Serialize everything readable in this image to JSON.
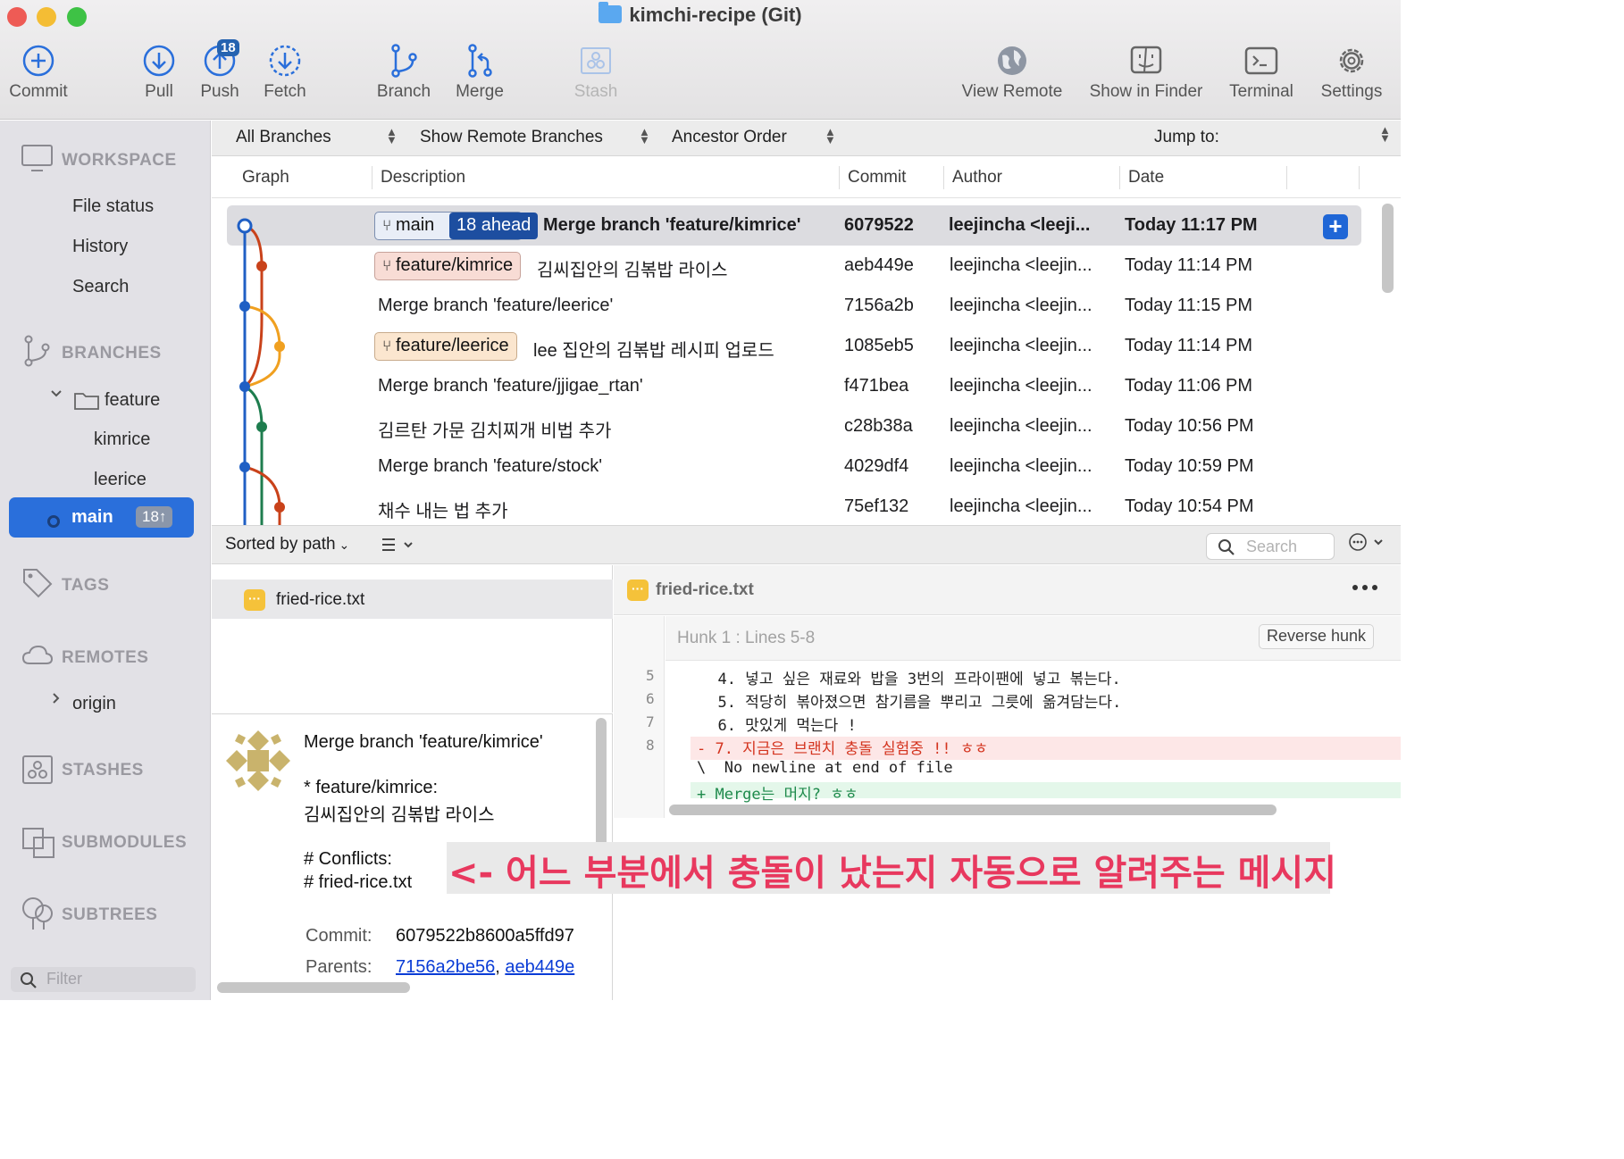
{
  "window": {
    "title": "kimchi-recipe (Git)"
  },
  "toolbar": {
    "commit": "Commit",
    "pull": "Pull",
    "push": "Push",
    "push_badge": "18",
    "fetch": "Fetch",
    "branch": "Branch",
    "merge": "Merge",
    "stash": "Stash",
    "view_remote": "View Remote",
    "show_in_finder": "Show in Finder",
    "terminal": "Terminal",
    "settings": "Settings"
  },
  "sidebar": {
    "workspace": "WORKSPACE",
    "workspace_items": [
      "File status",
      "History",
      "Search"
    ],
    "branches": "BRANCHES",
    "folder": "feature",
    "folder_items": [
      "kimrice",
      "leerice"
    ],
    "current_branch": "main",
    "current_badge": "18↑",
    "tags": "TAGS",
    "remotes": "REMOTES",
    "remote_items": [
      "origin"
    ],
    "stashes": "STASHES",
    "submodules": "SUBMODULES",
    "subtrees": "SUBTREES",
    "filter_placeholder": "Filter"
  },
  "filterbar": {
    "branches": "All Branches",
    "remote": "Show Remote Branches",
    "order": "Ancestor Order",
    "jump": "Jump to:"
  },
  "columns": {
    "graph": "Graph",
    "description": "Description",
    "commit": "Commit",
    "author": "Author",
    "date": "Date"
  },
  "commits": [
    {
      "branch": "main",
      "ahead": "18 ahead",
      "description": "Merge branch 'feature/kimrice'",
      "hash": "6079522",
      "author": "leejincha <leeji...",
      "date": "Today 11:17 PM"
    },
    {
      "branch": "feature/kimrice",
      "description": "김씨집안의 김볶밥 라이스",
      "hash": "aeb449e",
      "author": "leejincha <leejin...",
      "date": "Today 11:14 PM"
    },
    {
      "description": "Merge branch 'feature/leerice'",
      "hash": "7156a2b",
      "author": "leejincha <leejin...",
      "date": "Today 11:15 PM"
    },
    {
      "branch": "feature/leerice",
      "description": "lee 집안의 김볶밥 레시피 업로드",
      "hash": "1085eb5",
      "author": "leejincha <leejin...",
      "date": "Today 11:14 PM"
    },
    {
      "description": "Merge branch 'feature/jjigae_rtan'",
      "hash": "f471bea",
      "author": "leejincha <leejin...",
      "date": "Today 11:06 PM"
    },
    {
      "description": "김르탄 가문 김치찌개 비법 추가",
      "hash": "c28b38a",
      "author": "leejincha <leejin...",
      "date": "Today 10:56 PM"
    },
    {
      "description": "Merge branch 'feature/stock'",
      "hash": "4029df4",
      "author": "leejincha <leejin...",
      "date": "Today 10:59 PM"
    },
    {
      "description": "채수 내는 법 추가",
      "hash": "75ef132",
      "author": "leejincha <leejin...",
      "date": "Today 10:54 PM"
    }
  ],
  "lowerbar": {
    "sort": "Sorted by path",
    "search_placeholder": "Search"
  },
  "files": [
    {
      "name": "fried-rice.txt"
    }
  ],
  "details": {
    "subject": "Merge branch 'feature/kimrice'",
    "body_line1": "* feature/kimrice:",
    "body_line2": "김씨집안의 김볶밥 라이스",
    "conflicts_label": "# Conflicts:",
    "conflicts_file": "# fried-rice.txt",
    "commit_label": "Commit:",
    "commit_value": "6079522b8600a5ffd97",
    "parents_label": "Parents:",
    "parent1": "7156a2be56",
    "parent_sep": ",",
    "parent2": "aeb449e"
  },
  "diff": {
    "file": "fried-rice.txt",
    "hunk": "Hunk 1 : Lines 5-8",
    "reverse": "Reverse hunk",
    "lines": [
      {
        "num": "5",
        "text": "  4. 넣고 싶은 재료와 밥을 3번의 프라이팬에 넣고 볶는다."
      },
      {
        "num": "6",
        "text": "  5. 적당히 볶아졌으면 참기름을 뿌리고 그릇에 옮겨담는다."
      },
      {
        "num": "7",
        "text": "  6. 맛있게 먹는다 !"
      },
      {
        "num": "8",
        "text": "- 7. 지금은 브랜치 충돌 실험중 !! ㅎㅎ"
      },
      {
        "num": "",
        "text": "\\  No newline at end of file"
      },
      {
        "num": "",
        "text": "+ Merge는 머지? ㅎㅎ"
      }
    ]
  },
  "annotation": "<- 어느 부분에서 충돌이 났는지 자동으로 알려주는 메시지",
  "colors": {
    "accent": "#2a6fdb",
    "removed": "#d4341f",
    "added": "#1f8a4c",
    "annotation": "#e8385e",
    "graph_main": "#1f5fc4",
    "graph_kimrice": "#c9421a",
    "graph_leerice": "#f0a020",
    "graph_jjigae": "#1e7d4e"
  }
}
